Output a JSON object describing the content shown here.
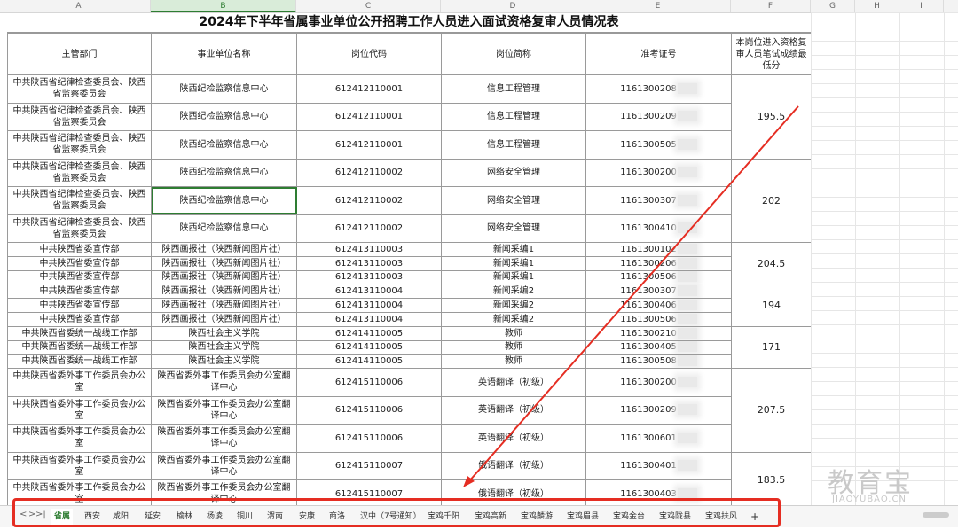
{
  "columns": [
    "A",
    "B",
    "C",
    "D",
    "E",
    "F",
    "G",
    "H",
    "I"
  ],
  "title": "2024年下半年省属事业单位公开招聘工作人员进入面试资格复审人员情况表",
  "headers": [
    "主管部门",
    "事业单位名称",
    "岗位代码",
    "岗位简称",
    "准考证号",
    "本岗位进入资格复审人员笔试成绩最低分"
  ],
  "rows": [
    [
      "中共陕西省纪律检查委员会、陕西省监察委员会",
      "陕西纪检监察信息中心",
      "612412110001",
      "信息工程管理",
      "1161300208"
    ],
    [
      "中共陕西省纪律检查委员会、陕西省监察委员会",
      "陕西纪检监察信息中心",
      "612412110001",
      "信息工程管理",
      "1161300209"
    ],
    [
      "中共陕西省纪律检查委员会、陕西省监察委员会",
      "陕西纪检监察信息中心",
      "612412110001",
      "信息工程管理",
      "1161300505"
    ],
    [
      "中共陕西省纪律检查委员会、陕西省监察委员会",
      "陕西纪检监察信息中心",
      "612412110002",
      "网络安全管理",
      "1161300200"
    ],
    [
      "中共陕西省纪律检查委员会、陕西省监察委员会",
      "陕西纪检监察信息中心",
      "612412110002",
      "网络安全管理",
      "1161300307"
    ],
    [
      "中共陕西省纪律检查委员会、陕西省监察委员会",
      "陕西纪检监察信息中心",
      "612412110002",
      "网络安全管理",
      "1161300410"
    ],
    [
      "中共陕西省委宣传部",
      "陕西画报社（陕西新闻图片社）",
      "612413110003",
      "新闻采编1",
      "1161300102"
    ],
    [
      "中共陕西省委宣传部",
      "陕西画报社（陕西新闻图片社）",
      "612413110003",
      "新闻采编1",
      "1161300206"
    ],
    [
      "中共陕西省委宣传部",
      "陕西画报社（陕西新闻图片社）",
      "612413110003",
      "新闻采编1",
      "1161300506"
    ],
    [
      "中共陕西省委宣传部",
      "陕西画报社（陕西新闻图片社）",
      "612413110004",
      "新闻采编2",
      "1161300307"
    ],
    [
      "中共陕西省委宣传部",
      "陕西画报社（陕西新闻图片社）",
      "612413110004",
      "新闻采编2",
      "1161300406"
    ],
    [
      "中共陕西省委宣传部",
      "陕西画报社（陕西新闻图片社）",
      "612413110004",
      "新闻采编2",
      "1161300506"
    ],
    [
      "中共陕西省委统一战线工作部",
      "陕西社会主义学院",
      "612414110005",
      "教师",
      "1161300210"
    ],
    [
      "中共陕西省委统一战线工作部",
      "陕西社会主义学院",
      "612414110005",
      "教师",
      "1161300405"
    ],
    [
      "中共陕西省委统一战线工作部",
      "陕西社会主义学院",
      "612414110005",
      "教师",
      "1161300508"
    ],
    [
      "中共陕西省委外事工作委员会办公室",
      "陕西省委外事工作委员会办公室翻译中心",
      "612415110006",
      "英语翻译（初级）",
      "1161300200"
    ],
    [
      "中共陕西省委外事工作委员会办公室",
      "陕西省委外事工作委员会办公室翻译中心",
      "612415110006",
      "英语翻译（初级）",
      "1161300209"
    ],
    [
      "中共陕西省委外事工作委员会办公室",
      "陕西省委外事工作委员会办公室翻译中心",
      "612415110006",
      "英语翻译（初级）",
      "1161300601"
    ],
    [
      "中共陕西省委外事工作委员会办公室",
      "陕西省委外事工作委员会办公室翻译中心",
      "612415110007",
      "俄语翻译（初级）",
      "1161300401"
    ],
    [
      "中共陕西省委外事工作委员会办公室",
      "陕西省委外事工作委员会办公室翻译中心",
      "612415110007",
      "俄语翻译（初级）",
      "1161300403"
    ]
  ],
  "scores": [
    "195.5",
    "202",
    "204.5",
    "194",
    "171",
    "207.5",
    "183.5"
  ],
  "tabs": [
    "省属",
    "西安",
    "咸阳",
    "延安",
    "榆林",
    "杨凌",
    "铜川",
    "渭南",
    "安康",
    "商洛",
    "汉中（7号通知）",
    "宝鸡千阳",
    "宝鸡高新",
    "宝鸡麟游",
    "宝鸡眉县",
    "宝鸡金台",
    "宝鸡陇县",
    "宝鸡扶风"
  ],
  "add_tab": "+",
  "nav": [
    "<",
    ">",
    ">|"
  ],
  "watermark": "教育宝",
  "watermark_url": "JIAOYUBAO.CN",
  "colors": {
    "annotation": "#e52d22",
    "accent": "#2e7d32"
  }
}
